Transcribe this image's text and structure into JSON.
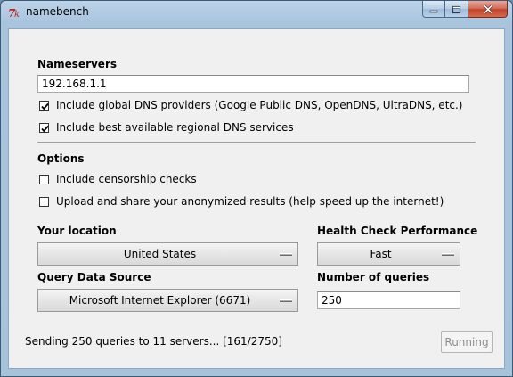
{
  "window": {
    "title": "namebench",
    "app_icon": "tk-feather-icon",
    "caption_buttons": [
      "minimize-icon",
      "maximize-icon",
      "close-icon"
    ]
  },
  "nameservers": {
    "heading": "Nameservers",
    "value": "192.168.1.1",
    "include_global": {
      "label": "Include global DNS providers (Google Public DNS, OpenDNS, UltraDNS, etc.)",
      "checked": true
    },
    "include_regional": {
      "label": "Include best available regional DNS services",
      "checked": true
    }
  },
  "options": {
    "heading": "Options",
    "censorship": {
      "label": "Include censorship checks",
      "checked": false
    },
    "upload": {
      "label": "Upload and share your anonymized results (help speed up the internet!)",
      "checked": false
    }
  },
  "location": {
    "heading": "Your location",
    "selected": "United States"
  },
  "health_check": {
    "heading": "Health Check Performance",
    "selected": "Fast"
  },
  "query_source": {
    "heading": "Query Data Source",
    "selected": "Microsoft Internet Explorer (6671)"
  },
  "num_queries": {
    "heading": "Number of queries",
    "value": "250"
  },
  "status": {
    "text": "Sending 250 queries to 11 servers... [161/2750]",
    "button_label": "Running",
    "button_enabled": false
  },
  "colors": {
    "titlebar": "#a9c5de",
    "client_bg": "#f0f0f0",
    "close_button": "#c2442a",
    "disabled_text": "#8d8d8d"
  }
}
